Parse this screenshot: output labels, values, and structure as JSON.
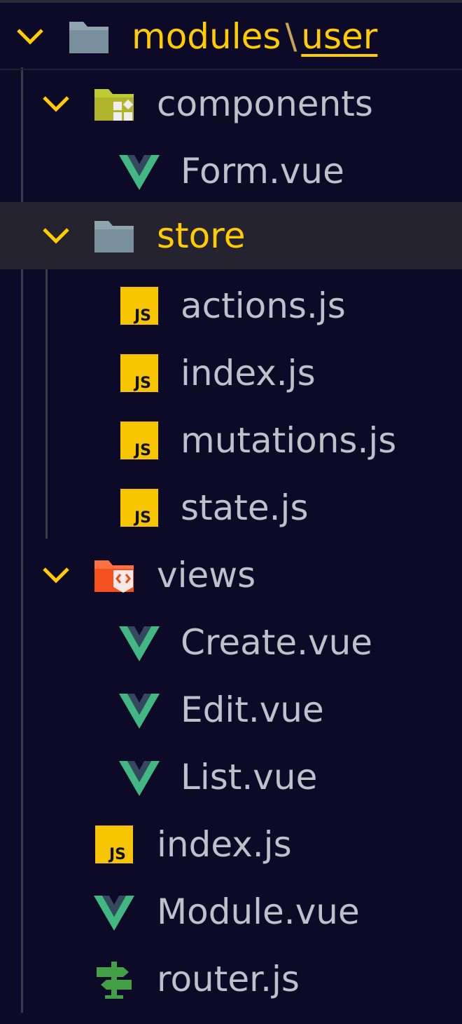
{
  "colors": {
    "background": "#0c0a26",
    "selected_row": "#25232f",
    "label": "#c0c0c8",
    "highlight": "#ffcc00",
    "vue_green": "#41b883",
    "vue_dark": "#35495e",
    "js_yellow": "#f7c500"
  },
  "breadcrumb": {
    "segment_1": "modules",
    "separator": "\\",
    "segment_2": "user",
    "icon": "folder-icon"
  },
  "tree": {
    "components": {
      "label": "components",
      "icon": "components-folder-icon"
    },
    "form": {
      "label": "Form.vue",
      "icon": "vue-icon"
    },
    "store": {
      "label": "store",
      "icon": "folder-icon",
      "selected": true
    },
    "actions": {
      "label": "actions.js",
      "icon": "js-icon"
    },
    "store_index": {
      "label": "index.js",
      "icon": "js-icon"
    },
    "mutations": {
      "label": "mutations.js",
      "icon": "js-icon"
    },
    "state": {
      "label": "state.js",
      "icon": "js-icon"
    },
    "views": {
      "label": "views",
      "icon": "views-folder-icon"
    },
    "create": {
      "label": "Create.vue",
      "icon": "vue-icon"
    },
    "edit": {
      "label": "Edit.vue",
      "icon": "vue-icon"
    },
    "list": {
      "label": "List.vue",
      "icon": "vue-icon"
    },
    "index": {
      "label": "index.js",
      "icon": "js-icon"
    },
    "module": {
      "label": "Module.vue",
      "icon": "vue-icon"
    },
    "router": {
      "label": "router.js",
      "icon": "router-signpost-icon"
    }
  }
}
